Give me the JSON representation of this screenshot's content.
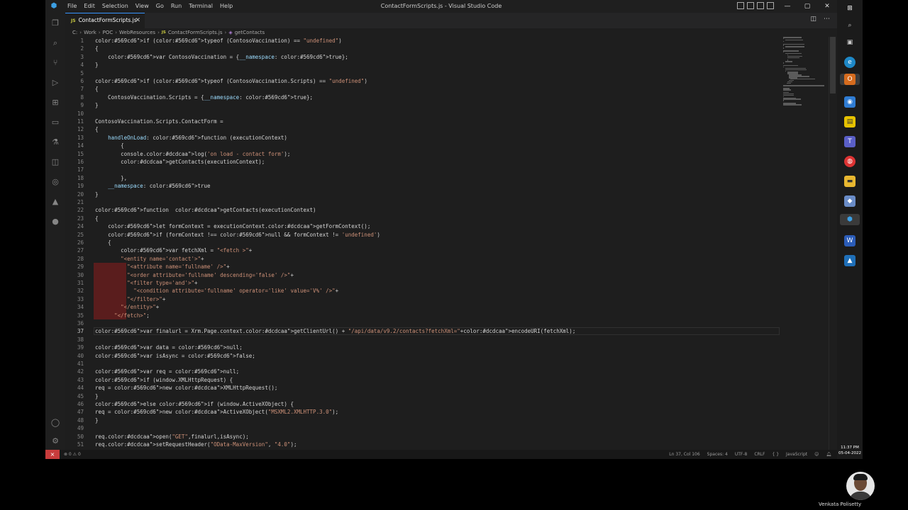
{
  "window": {
    "title": "ContactFormScripts.js - Visual Studio Code",
    "menu": [
      "File",
      "Edit",
      "Selection",
      "View",
      "Go",
      "Run",
      "Terminal",
      "Help"
    ],
    "controls": [
      "—",
      "▢",
      "✕"
    ]
  },
  "tab": {
    "label": "ContactFormScripts.js",
    "badge": "JS"
  },
  "breadcrumb": [
    "C:",
    "Work",
    "POC",
    "WebResources",
    "ContactFormScripts.js",
    "getContacts"
  ],
  "code": [
    "if (typeof (ContosoVaccination) == \"undefined\")",
    "{",
    "    var ContosoVaccination = {__namespace: true};",
    "}",
    "",
    "if (typeof (ContosoVaccination.Scripts) == \"undefined\")",
    "{",
    "    ContosoVaccination.Scripts = {__namespace: true};",
    "}",
    "",
    "ContosoVaccination.Scripts.ContactForm =",
    "{",
    "    handleOnLoad: function (executionContext)",
    "        {",
    "        console.log('on load - contact form');",
    "        getContacts(executionContext);",
    "",
    "        },",
    "    __namespace: true",
    "}",
    "",
    "function  getContacts(executionContext)",
    "{",
    "    let formContext = executionContext.getFormContext();",
    "    if (formContext !== null && formContext != 'undefined')",
    "    {",
    "        var fetchXml = \"<fetch >\"+",
    "        \"<entity name='contact'>\"+",
    "          \"<attribute name='fullname' />\"+",
    "          \"<order attribute='fullname' descending='false' />\"+",
    "          \"<filter type='and'>\"+",
    "            \"<condition attribute='fullname' operator='like' value='V%' />\"+",
    "          \"</filter>\"+",
    "        \"</entity>\"+",
    "      \"</fetch>\";",
    "",
    "var finalurl = Xrm.Page.context.getClientUrl() + \"/api/data/v9.2/contacts?fetchXml=\"+encodeURI(fetchXml);",
    "",
    "var data = null;",
    "var isAsync = false;",
    "",
    "var req = null;",
    "if (window.XMLHttpRequest) {",
    "req = new XMLHttpRequest();",
    "}",
    "else if (window.ActiveXObject) {",
    "req = new ActiveXObject(\"MSXML2.XMLHTTP.3.0\");",
    "}",
    "",
    "req.open(\"GET\",finalurl,isAsync);",
    "req.setRequestHeader(\"OData-MaxVersion\", \"4.0\");"
  ],
  "highlighted_lines": [
    29,
    30,
    31,
    32,
    33,
    34,
    35
  ],
  "current_line": 37,
  "status": {
    "left": "⊗ 0 ⚠ 0",
    "position": "Ln 37, Col 106",
    "spaces": "Spaces: 4",
    "encoding": "UTF-8",
    "eol": "CRLF",
    "language_braces": "{ }",
    "language": "JavaScript"
  },
  "taskbar": {
    "time": "11:37 PM",
    "date": "05-04-2022"
  },
  "presenter": {
    "name": "Venkata Polisetty"
  },
  "colors": {
    "editor_bg": "#1e1e1e",
    "keyword": "#569cd6",
    "string": "#ce9178",
    "function": "#dcdcaa",
    "accent": "#3794ff"
  }
}
